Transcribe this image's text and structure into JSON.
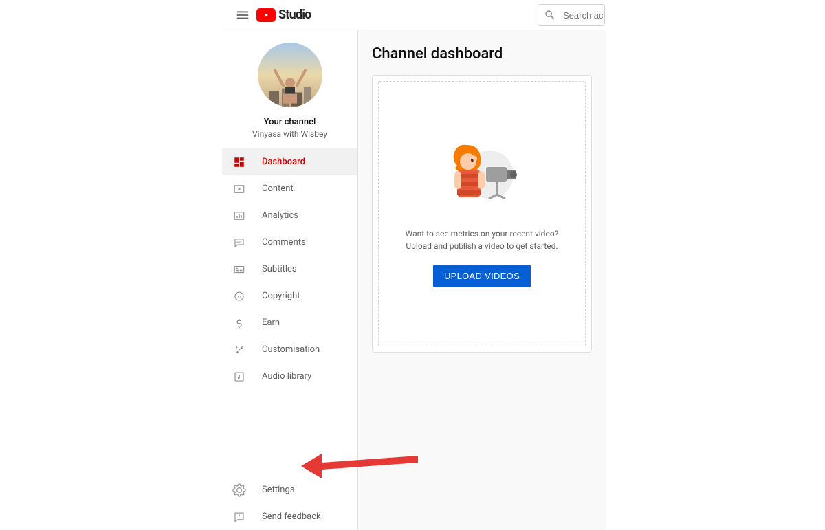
{
  "header": {
    "logo_text": "Studio",
    "search_placeholder": "Search ac"
  },
  "sidebar": {
    "your_channel_label": "Your channel",
    "channel_name": "Vinyasa with Wisbey",
    "items": [
      {
        "label": "Dashboard",
        "icon": "dashboard-icon",
        "active": true
      },
      {
        "label": "Content",
        "icon": "content-icon"
      },
      {
        "label": "Analytics",
        "icon": "analytics-icon"
      },
      {
        "label": "Comments",
        "icon": "comments-icon"
      },
      {
        "label": "Subtitles",
        "icon": "subtitles-icon"
      },
      {
        "label": "Copyright",
        "icon": "copyright-icon"
      },
      {
        "label": "Earn",
        "icon": "earn-icon"
      },
      {
        "label": "Customisation",
        "icon": "customisation-icon"
      },
      {
        "label": "Audio library",
        "icon": "audiolib-icon"
      }
    ],
    "bottom_items": [
      {
        "label": "Settings",
        "icon": "settings-icon"
      },
      {
        "label": "Send feedback",
        "icon": "feedback-icon"
      }
    ]
  },
  "main": {
    "title": "Channel dashboard",
    "card_line1": "Want to see metrics on your recent video?",
    "card_line2": "Upload and publish a video to get started.",
    "upload_label": "UPLOAD VIDEOS"
  }
}
